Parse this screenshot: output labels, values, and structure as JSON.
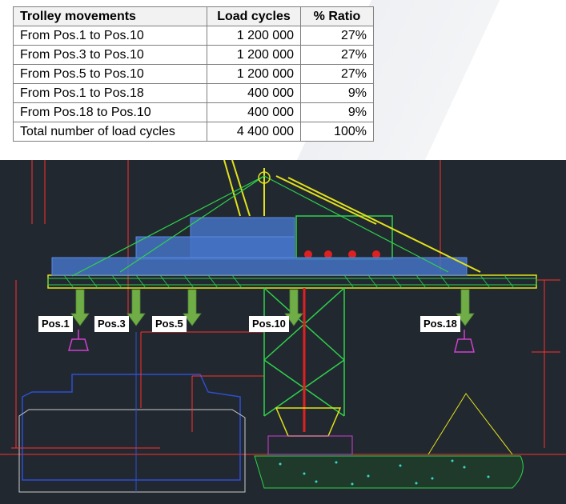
{
  "table": {
    "headers": [
      "Trolley movements",
      "Load cycles",
      "% Ratio"
    ],
    "rows": [
      {
        "movement": "From Pos.1 to Pos.10",
        "cycles": "1 200 000",
        "ratio": "27%"
      },
      {
        "movement": "From Pos.3 to Pos.10",
        "cycles": "1 200 000",
        "ratio": "27%"
      },
      {
        "movement": "From Pos.5 to Pos.10",
        "cycles": "1 200 000",
        "ratio": "27%"
      },
      {
        "movement": "From Pos.1 to Pos.18",
        "cycles": "400 000",
        "ratio": "9%"
      },
      {
        "movement": "From Pos.18 to Pos.10",
        "cycles": "400 000",
        "ratio": "9%"
      },
      {
        "movement": "Total number of load cycles",
        "cycles": "4 400 000",
        "ratio": "100%"
      }
    ]
  },
  "drawing": {
    "positions": [
      "Pos.1",
      "Pos.3",
      "Pos.5",
      "Pos.10",
      "Pos.18"
    ],
    "colors": {
      "background": "#212830",
      "crane_green": "#2fd24a",
      "crane_yellow": "#e2e21a",
      "crane_red": "#e02020",
      "load_blue": "#4472c4",
      "arrow_green": "#70ad47",
      "bucket_magenta": "#d040d0",
      "dim_red": "#ff3030",
      "ship_blue": "#2f4fd0"
    }
  }
}
